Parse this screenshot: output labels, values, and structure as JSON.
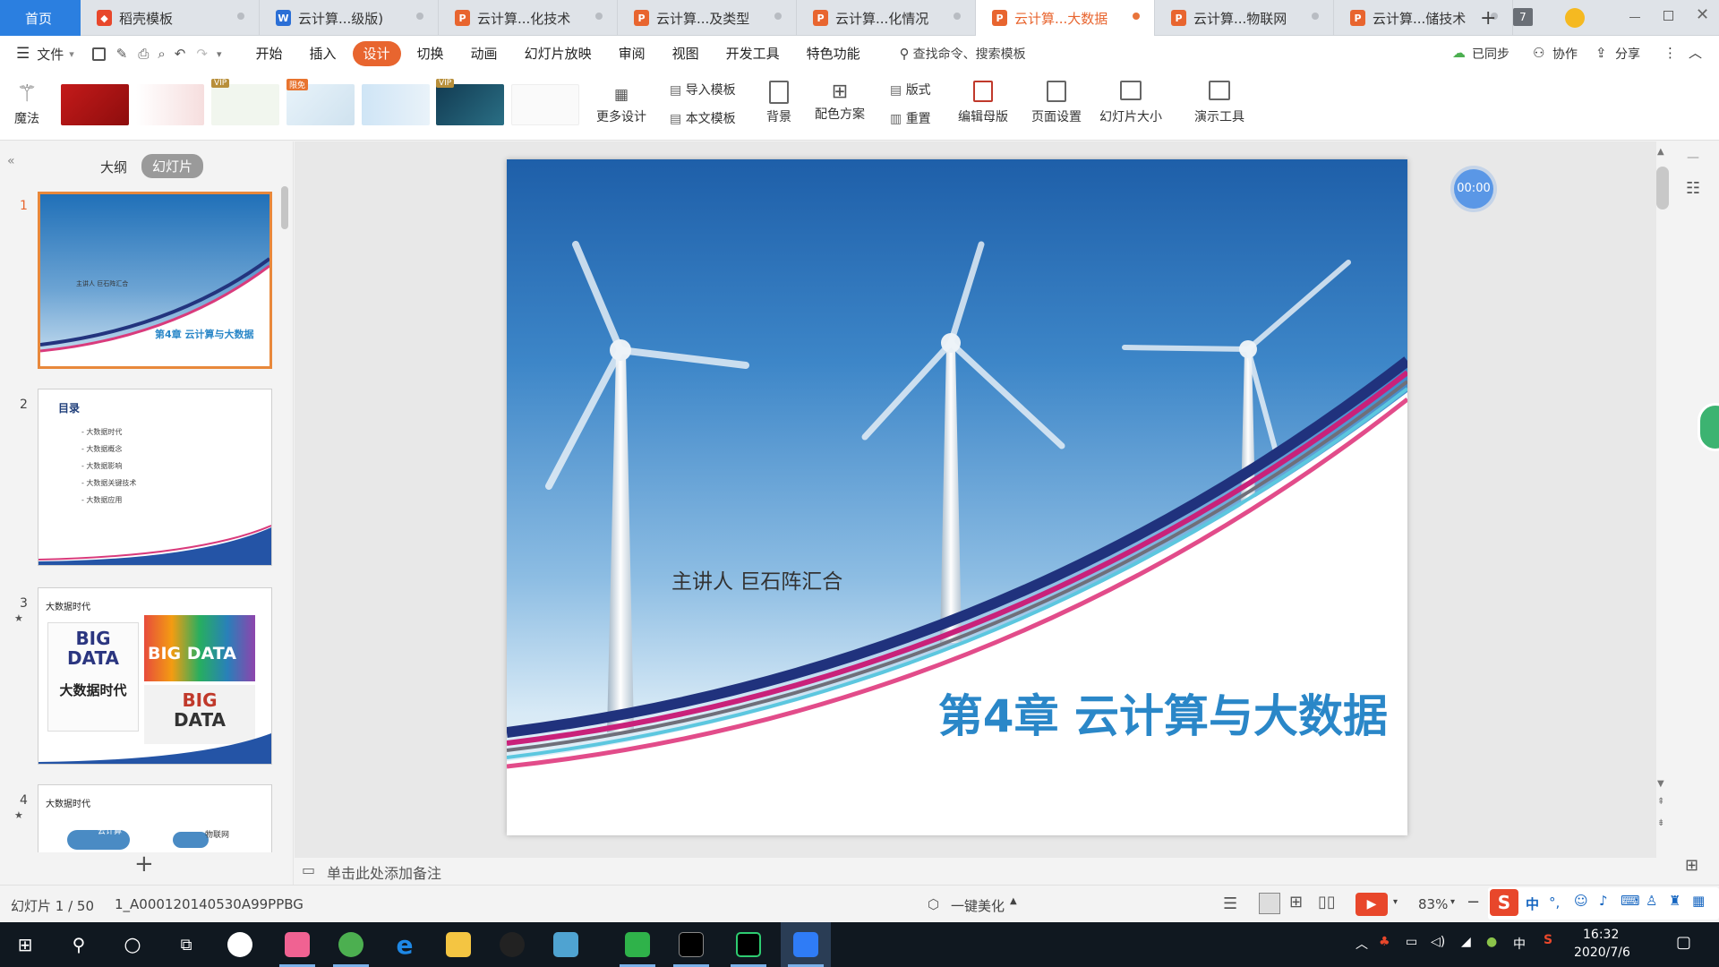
{
  "tabs": {
    "home": "首页",
    "items": [
      {
        "label": "稻壳模板",
        "icon": "docer-icon",
        "color": "#e8472b"
      },
      {
        "label": "云计算...级版)",
        "icon": "w-doc-icon",
        "color": "#2b6fd6"
      },
      {
        "label": "云计算...化技术",
        "icon": "p-doc-icon",
        "color": "#e8652f"
      },
      {
        "label": "云计算...及类型",
        "icon": "p-doc-icon",
        "color": "#e8652f"
      },
      {
        "label": "云计算...化情况",
        "icon": "p-doc-icon",
        "color": "#e8652f"
      },
      {
        "label": "云计算...大数据",
        "icon": "p-doc-icon",
        "color": "#e8652f",
        "active": true
      },
      {
        "label": "云计算...物联网",
        "icon": "p-doc-icon",
        "color": "#e8652f"
      },
      {
        "label": "云计算...储技术",
        "icon": "p-doc-icon",
        "color": "#e8652f"
      }
    ],
    "tab_count": "7"
  },
  "menu": {
    "file": "文件",
    "items": [
      "开始",
      "插入",
      "设计",
      "切换",
      "动画",
      "幻灯片放映",
      "审阅",
      "视图",
      "开发工具",
      "特色功能"
    ],
    "active": "设计",
    "search": "查找命令、搜索模板",
    "synced": "已同步",
    "collab": "协作",
    "share": "分享"
  },
  "ribbon": {
    "magic": "魔法",
    "more_design": "更多设计",
    "import_template": "导入模板",
    "text_template": "本文模板",
    "background": "背景",
    "color_scheme": "配色方案",
    "layout": "版式",
    "reset": "重置",
    "edit_master": "编辑母版",
    "page_setup": "页面设置",
    "slide_size": "幻灯片大小",
    "presenter_tools": "演示工具",
    "vip_badge": "VIP",
    "free_badge": "限免"
  },
  "panel": {
    "outline_tab": "大纲",
    "slides_tab": "幻灯片"
  },
  "thumbs": [
    {
      "num": "1",
      "title": "第4章 云计算与大数据",
      "subtitle": "主讲人 巨石阵汇合"
    },
    {
      "num": "2",
      "title": "目录",
      "items": [
        "- 大数据时代",
        "- 大数据概念",
        "- 大数据影响",
        "- 大数据关键技术",
        "- 大数据应用"
      ]
    },
    {
      "num": "3",
      "title": "大数据时代",
      "big_data": "BIG DATA",
      "cn": "大数据时代",
      "big": "BIG",
      "data": "DATA"
    },
    {
      "num": "4",
      "title": "大数据时代",
      "cloud": "云计算",
      "iot": "物联网"
    }
  ],
  "slide": {
    "presenter": "主讲人 巨石阵汇合",
    "title": "第4章 云计算与大数据"
  },
  "timer": "00:00",
  "notes_placeholder": "单击此处添加备注",
  "status": {
    "slide_pos": "幻灯片 1 / 50",
    "theme_name": "1_A000120140530A99PPBG",
    "beautify": "一键美化",
    "zoom": "83%"
  },
  "clock": {
    "time": "16:32",
    "date": "2020/7/6"
  },
  "ime": {
    "lang": "中",
    "tray_lang": "中"
  },
  "colors": {
    "accent": "#e8652f",
    "title_blue": "#2a87c8",
    "taskbar": "#101820"
  }
}
